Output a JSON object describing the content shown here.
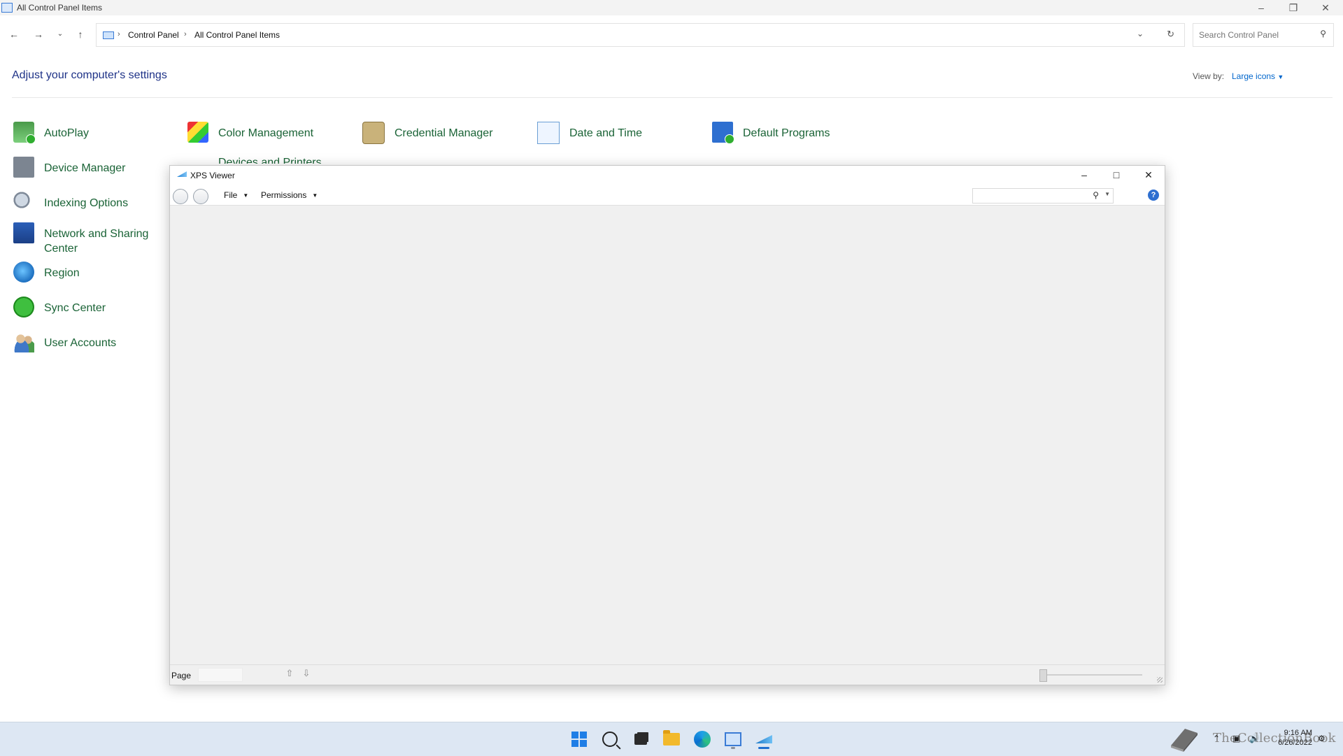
{
  "control_panel": {
    "window_title": "All Control Panel Items",
    "breadcrumb": [
      "Control Panel",
      "All Control Panel Items"
    ],
    "search_placeholder": "Search Control Panel",
    "heading": "Adjust your computer's settings",
    "view_by_label": "View by:",
    "view_by_value": "Large icons",
    "items": [
      {
        "label": "AutoPlay",
        "icon": "autoplay-icon"
      },
      {
        "label": "Color Management",
        "icon": "color-management-icon"
      },
      {
        "label": "Credential Manager",
        "icon": "credential-manager-icon"
      },
      {
        "label": "Date and Time",
        "icon": "date-time-icon"
      },
      {
        "label": "Default Programs",
        "icon": "default-programs-icon"
      },
      {
        "label": "Device Manager",
        "icon": "device-manager-icon"
      },
      {
        "label": "Indexing Options",
        "icon": "indexing-options-icon"
      },
      {
        "label": "Network and Sharing Center",
        "icon": "network-icon"
      },
      {
        "label": "Region",
        "icon": "region-icon"
      },
      {
        "label": "Sync Center",
        "icon": "sync-icon"
      },
      {
        "label": "User Accounts",
        "icon": "user-accounts-icon"
      }
    ],
    "partially_hidden_label": "Devices and Printers"
  },
  "xps_viewer": {
    "title": "XPS Viewer",
    "menus": {
      "file": "File",
      "permissions": "Permissions"
    },
    "status": {
      "page_label": "Page"
    }
  },
  "taskbar": {
    "apps": [
      "start-icon",
      "search-icon",
      "task-view-icon",
      "file-explorer-icon",
      "edge-icon",
      "control-panel-icon",
      "xps-viewer-icon"
    ],
    "time": "9:16 AM",
    "date": "6/26/2022"
  },
  "watermark": "TheCollectionBook",
  "colors": {
    "link": "#1a6336",
    "heading": "#1e3287",
    "accent": "#1f7ee6"
  }
}
